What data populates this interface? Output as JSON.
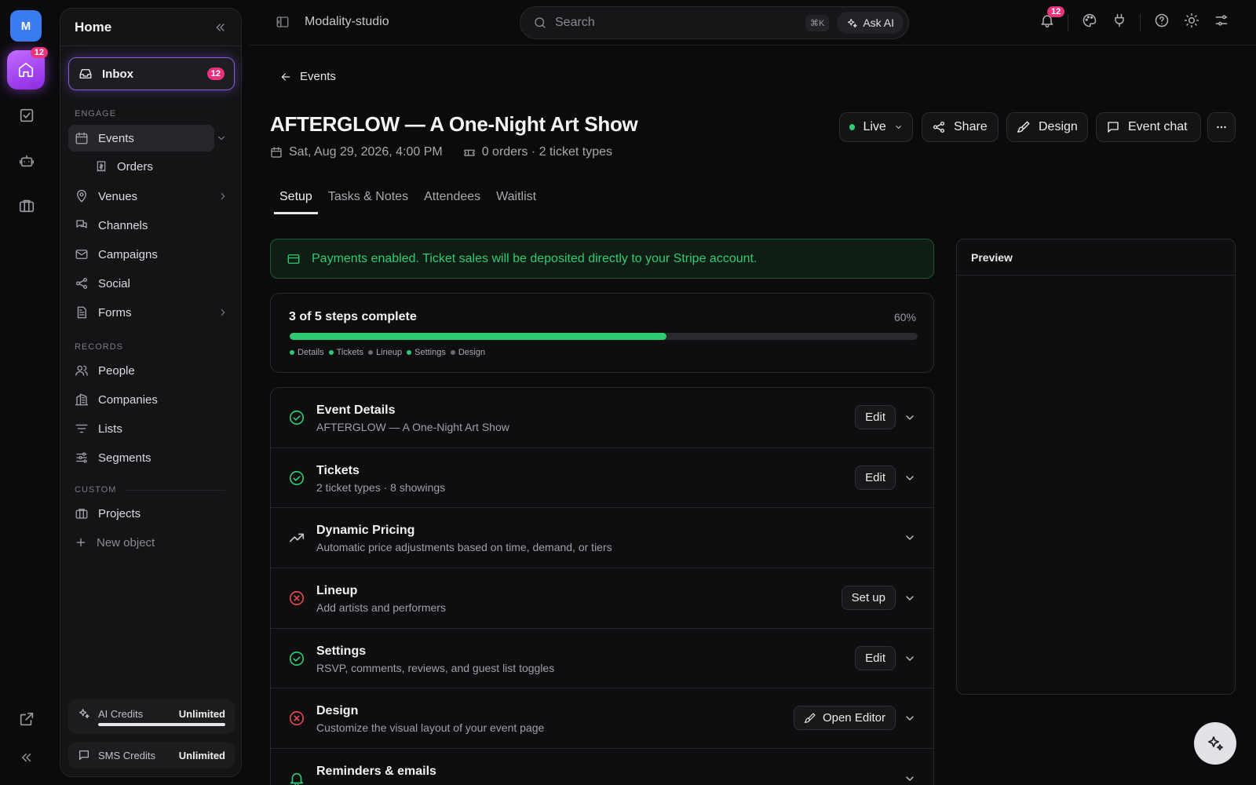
{
  "rail": {
    "avatar_letter": "M",
    "home_badge": "12"
  },
  "sidebar": {
    "title": "Home",
    "inbox": {
      "label": "Inbox",
      "badge": "12"
    },
    "sections": {
      "engage": "ENGAGE",
      "records": "RECORDS",
      "custom": "CUSTOM"
    },
    "items": {
      "events": "Events",
      "orders": "Orders",
      "venues": "Venues",
      "channels": "Channels",
      "campaigns": "Campaigns",
      "social": "Social",
      "forms": "Forms",
      "people": "People",
      "companies": "Companies",
      "lists": "Lists",
      "segments": "Segments",
      "projects": "Projects",
      "new_object": "New object"
    },
    "credits": {
      "ai_label": "AI Credits",
      "ai_value": "Unlimited",
      "ai_fill": 1.0,
      "sms_label": "SMS Credits",
      "sms_value": "Unlimited"
    }
  },
  "topbar": {
    "workspace": "Modality-studio",
    "search_placeholder": "Search",
    "shortcut": "⌘K",
    "ask_ai": "Ask AI",
    "notifications_badge": "12"
  },
  "event": {
    "back_label": "Events",
    "title": "AFTERGLOW — A One-Night Art Show",
    "date": "Sat, Aug 29, 2026, 4:00 PM",
    "orders_meta": "0 orders · 2 ticket types",
    "status": "Live",
    "actions": {
      "share": "Share",
      "design": "Design",
      "chat": "Event chat"
    }
  },
  "tabs": [
    "Setup",
    "Tasks & Notes",
    "Attendees",
    "Waitlist"
  ],
  "payments_notice": "Payments enabled. Ticket sales will be deposited directly to your Stripe account.",
  "progress": {
    "title": "3 of 5 steps complete",
    "percent_label": "60%",
    "fraction": 0.6,
    "steps": [
      {
        "label": "Details",
        "done": true
      },
      {
        "label": "Tickets",
        "done": true
      },
      {
        "label": "Lineup",
        "done": false
      },
      {
        "label": "Settings",
        "done": true
      },
      {
        "label": "Design",
        "done": false
      }
    ],
    "color_done": "#2ecc71",
    "color_todo": "#6b6b70"
  },
  "sections": [
    {
      "title": "Event Details",
      "subtitle": "AFTERGLOW — A One-Night Art Show",
      "status": "done",
      "action": "Edit"
    },
    {
      "title": "Tickets",
      "subtitle": "2 ticket types · 8 showings",
      "status": "done",
      "action": "Edit"
    },
    {
      "title": "Dynamic Pricing",
      "subtitle": "Automatic price adjustments based on time, demand, or tiers",
      "status": "trend",
      "action": ""
    },
    {
      "title": "Lineup",
      "subtitle": "Add artists and performers",
      "status": "error",
      "action": "Set up"
    },
    {
      "title": "Settings",
      "subtitle": "RSVP, comments, reviews, and guest list toggles",
      "status": "done",
      "action": "Edit"
    },
    {
      "title": "Design",
      "subtitle": "Customize the visual layout of your event page",
      "status": "error",
      "action": "Open Editor"
    },
    {
      "title": "Reminders & emails",
      "subtitle": "",
      "status": "bell",
      "action": ""
    }
  ],
  "preview": {
    "title": "Preview"
  },
  "colors": {
    "accent_green": "#2ecc71",
    "error_red": "#e5484d",
    "badge_pink": "#e8327a",
    "brand_purple": "#9b4dff"
  }
}
